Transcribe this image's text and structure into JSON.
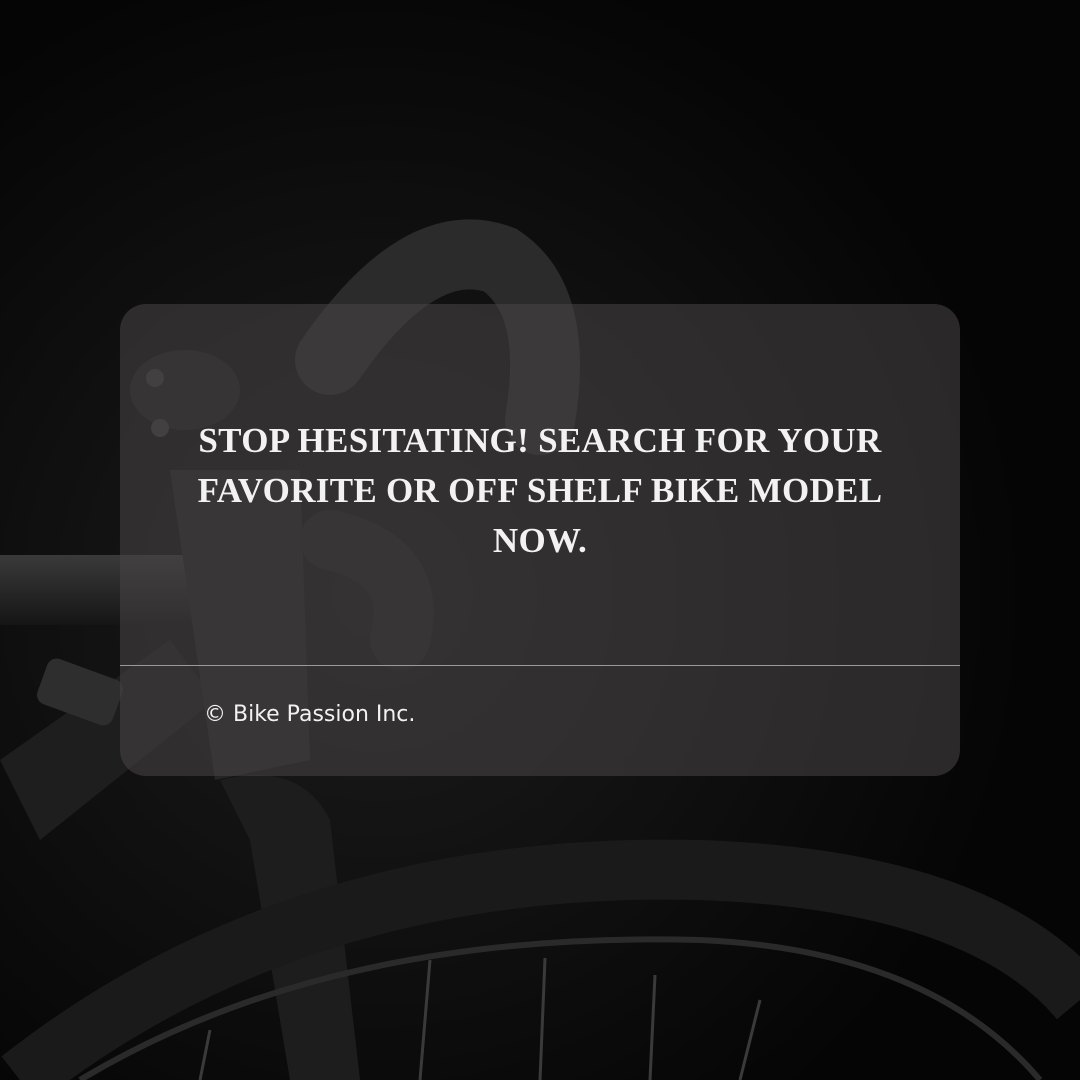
{
  "card": {
    "headline_lines": [
      "STOP HESITATING! SEARCH FOR YOUR",
      "FAVORITE OR OFF SHELF BIKE MODEL",
      "NOW."
    ],
    "copyright": "© Bike Passion Inc."
  },
  "background": {
    "subject": "bicycle-photo",
    "colors": {
      "base": "#050505",
      "card": "#484646",
      "text": "#f2f2f2",
      "divider": "#9a9a9a"
    }
  }
}
